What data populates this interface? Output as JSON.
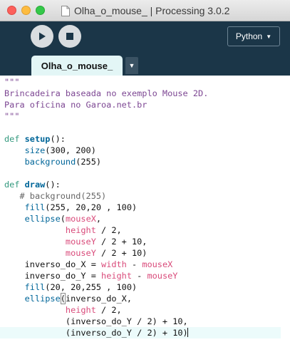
{
  "window": {
    "title": "Olha_o_mouse_ | Processing 3.0.2"
  },
  "toolbar": {
    "run_icon": "play-icon",
    "stop_icon": "stop-icon",
    "mode_label": "Python",
    "mode_caret": "▼"
  },
  "tabs": [
    {
      "label": "Olha_o_mouse_"
    }
  ],
  "tab_menu_glyph": "▼",
  "colors": {
    "toolbar_bg": "#1b3648",
    "tab_bg": "#e3f6f6",
    "keyword": "#33997e",
    "function": "#006699",
    "string": "#7d4793",
    "variable": "#d94a7a",
    "comment": "#666666"
  },
  "editor": {
    "lines": [
      [
        {
          "t": "\"\"\"",
          "c": "str"
        }
      ],
      [
        {
          "t": "Brincadeira baseada no exemplo Mouse 2D.",
          "c": "str"
        }
      ],
      [
        {
          "t": "Para oficina no Garoa.net.br",
          "c": "str"
        }
      ],
      [
        {
          "t": "\"\"\"",
          "c": "str"
        }
      ],
      [],
      [
        {
          "t": "def ",
          "c": "kw"
        },
        {
          "t": "setup",
          "c": "fnb"
        },
        {
          "t": "():",
          "c": ""
        }
      ],
      [
        {
          "t": "    ",
          "c": ""
        },
        {
          "t": "size",
          "c": "fn"
        },
        {
          "t": "(300, 200)",
          "c": ""
        }
      ],
      [
        {
          "t": "    ",
          "c": ""
        },
        {
          "t": "background",
          "c": "fn"
        },
        {
          "t": "(255)",
          "c": ""
        }
      ],
      [],
      [
        {
          "t": "def ",
          "c": "kw"
        },
        {
          "t": "draw",
          "c": "fnb"
        },
        {
          "t": "():",
          "c": ""
        }
      ],
      [
        {
          "t": "   # background(255)",
          "c": "cmt"
        }
      ],
      [
        {
          "t": "    ",
          "c": ""
        },
        {
          "t": "fill",
          "c": "fn"
        },
        {
          "t": "(255, 20,20 , 100)",
          "c": ""
        }
      ],
      [
        {
          "t": "    ",
          "c": ""
        },
        {
          "t": "ellipse",
          "c": "fn"
        },
        {
          "t": "(",
          "c": ""
        },
        {
          "t": "mouseX",
          "c": "var"
        },
        {
          "t": ",",
          "c": ""
        }
      ],
      [
        {
          "t": "            ",
          "c": ""
        },
        {
          "t": "height",
          "c": "var"
        },
        {
          "t": " / 2,",
          "c": ""
        }
      ],
      [
        {
          "t": "            ",
          "c": ""
        },
        {
          "t": "mouseY",
          "c": "var"
        },
        {
          "t": " / 2 + 10,",
          "c": ""
        }
      ],
      [
        {
          "t": "            ",
          "c": ""
        },
        {
          "t": "mouseY",
          "c": "var"
        },
        {
          "t": " / 2 + 10)",
          "c": ""
        }
      ],
      [
        {
          "t": "    inverso_do_X = ",
          "c": ""
        },
        {
          "t": "width",
          "c": "var"
        },
        {
          "t": " - ",
          "c": ""
        },
        {
          "t": "mouseX",
          "c": "var"
        }
      ],
      [
        {
          "t": "    inverso_do_Y = ",
          "c": ""
        },
        {
          "t": "height",
          "c": "var"
        },
        {
          "t": " - ",
          "c": ""
        },
        {
          "t": "mouseY",
          "c": "var"
        }
      ],
      [
        {
          "t": "    ",
          "c": ""
        },
        {
          "t": "fill",
          "c": "fn"
        },
        {
          "t": "(20, 20,255 , 100)",
          "c": ""
        }
      ],
      [
        {
          "t": "    ",
          "c": ""
        },
        {
          "t": "ellipse",
          "c": "fn"
        },
        {
          "t": "(",
          "c": "bracket"
        },
        {
          "t": "inverso_do_X,",
          "c": ""
        }
      ],
      [
        {
          "t": "            ",
          "c": ""
        },
        {
          "t": "height",
          "c": "var"
        },
        {
          "t": " / 2,",
          "c": ""
        }
      ],
      [
        {
          "t": "            (inverso_do_Y / 2) + 10,",
          "c": ""
        }
      ],
      [
        {
          "t": "            (inverso_do_Y / 2) + 10)",
          "c": ""
        },
        {
          "t": "",
          "c": "caret"
        }
      ]
    ],
    "current_line": 22
  }
}
